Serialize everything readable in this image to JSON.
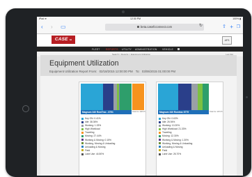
{
  "status": {
    "left": "iPad ≋",
    "time": "12:30 PM",
    "right": "100% ▮"
  },
  "browser": {
    "url": "beta.casefcconnect.com"
  },
  "header": {
    "logo": "CASE",
    "logo_sub": "IH",
    "afs": "AFS"
  },
  "nav": {
    "items": [
      "FLEET",
      "REPORTS",
      "UTILITY",
      "ADMINISTRATION",
      "VEHICLE"
    ],
    "active": "REPORTS"
  },
  "breadcrumb": {
    "path": "Search > Reports > Equipment Utilization",
    "logout": "Log Out"
  },
  "page": {
    "title": "Equipment Utilization",
    "subtitle": "Equipment Utilization Report From:",
    "from": "02/18/2015 12:00:00 PM",
    "to_label": "To:",
    "to": "03/06/2015 01:00:00 PM"
  },
  "legend_colors": [
    "#2aa5d6",
    "#2a3f8a",
    "#9aa0a6",
    "#7cc142",
    "#f7931e",
    "#2e9e6b",
    "#5c3c8c",
    "#6d8f38",
    "#2a7fbf",
    "#c8b01e",
    "#555555",
    "#3a3a3a",
    "#d94f2a"
  ],
  "cards": [
    {
      "name": "Magnum 340 RowTrac - 8751",
      "hours": "Total hrs: 1045 Hr",
      "stack": [
        {
          "color": "#2aa5d6",
          "frac": 0.44
        },
        {
          "color": "#2a3f8a",
          "frac": 0.2
        },
        {
          "color": "#9aa0a6",
          "frac": 0.07
        },
        {
          "color": "#7cc142",
          "frac": 0.04
        },
        {
          "color": "#7b79b8",
          "frac": 0.02
        },
        {
          "color": "#2e9e6b",
          "frac": 0.23
        }
      ],
      "legend": [
        "Key ON: 0.41%",
        "Idle: 38.36%",
        "Working: 1.33%",
        "High Workload",
        "Traveling",
        "Moving: 27.44%",
        "Working & Moving: 0.15%",
        "Working, Moving & Unloading",
        "Unloading & Moving",
        "Field",
        "Lane Use: 44.50%",
        "",
        ""
      ]
    },
    {
      "name": "Magnum 340 Rowtrac 8779",
      "hours": "Total hrs: 1070 Hr",
      "stack": [
        {
          "color": "#2aa5d6",
          "frac": 0.4
        },
        {
          "color": "#2a3f8a",
          "frac": 0.26
        },
        {
          "color": "#9aa0a6",
          "frac": 0.12
        },
        {
          "color": "#7cc142",
          "frac": 0.1
        },
        {
          "color": "#2e9e6b",
          "frac": 0.12
        }
      ],
      "legend": [
        "Key ON: 0.63%",
        "Idle: 26.94%",
        "Working: 10.20%",
        "High Workload: 21.33%",
        "Traveling",
        "Moving: 12.30%",
        "Working & Moving: 1.30%",
        "Working, Moving & Unloading",
        "Unloading & Moving",
        "Field",
        "Lane Use: 26.70%",
        "",
        ""
      ]
    }
  ]
}
